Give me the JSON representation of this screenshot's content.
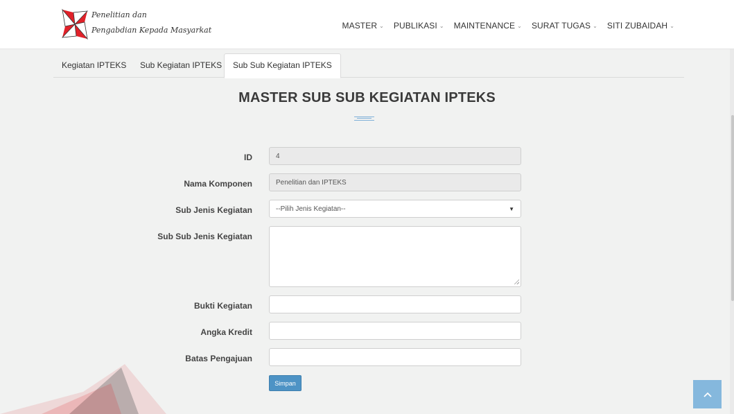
{
  "brand": {
    "line1": "Penelitian dan",
    "line2": "Pengabdian Kepada Masyarkat"
  },
  "nav": {
    "items": [
      {
        "label": "MASTER"
      },
      {
        "label": "PUBLIKASI"
      },
      {
        "label": "MAINTENANCE"
      },
      {
        "label": "SURAT TUGAS"
      },
      {
        "label": "SITI ZUBAIDAH"
      }
    ]
  },
  "tabs": [
    {
      "label": "Kegiatan IPTEKS",
      "active": false
    },
    {
      "label": "Sub Kegiatan IPTEKS",
      "active": false
    },
    {
      "label": "Sub Sub Kegiatan IPTEKS",
      "active": true
    }
  ],
  "page": {
    "title": "MASTER SUB SUB KEGIATAN IPTEKS"
  },
  "form": {
    "id": {
      "label": "ID",
      "value": "4"
    },
    "nama_komponen": {
      "label": "Nama Komponen",
      "value": "Penelitian dan IPTEKS"
    },
    "sub_jenis_kegiatan": {
      "label": "Sub Jenis Kegiatan",
      "selected": "--Pilih Jenis Kegiatan--"
    },
    "sub_sub_jenis_kegiatan": {
      "label": "Sub Sub Jenis Kegiatan",
      "value": ""
    },
    "bukti_kegiatan": {
      "label": "Bukti Kegiatan",
      "value": ""
    },
    "angka_kredit": {
      "label": "Angka Kredit",
      "value": ""
    },
    "batas_pengajuan": {
      "label": "Batas Pengajuan",
      "value": ""
    },
    "submit_label": "Simpan"
  },
  "colors": {
    "accent": "#4d93c5",
    "logo_red": "#e02129",
    "back_to_top": "#85b8dd"
  },
  "icons": {
    "nav_dropdown": "chevron-down-icon",
    "select_arrow": "caret-down-icon",
    "back_to_top": "chevron-up-icon",
    "brand_logo": "pinwheel-logo"
  }
}
